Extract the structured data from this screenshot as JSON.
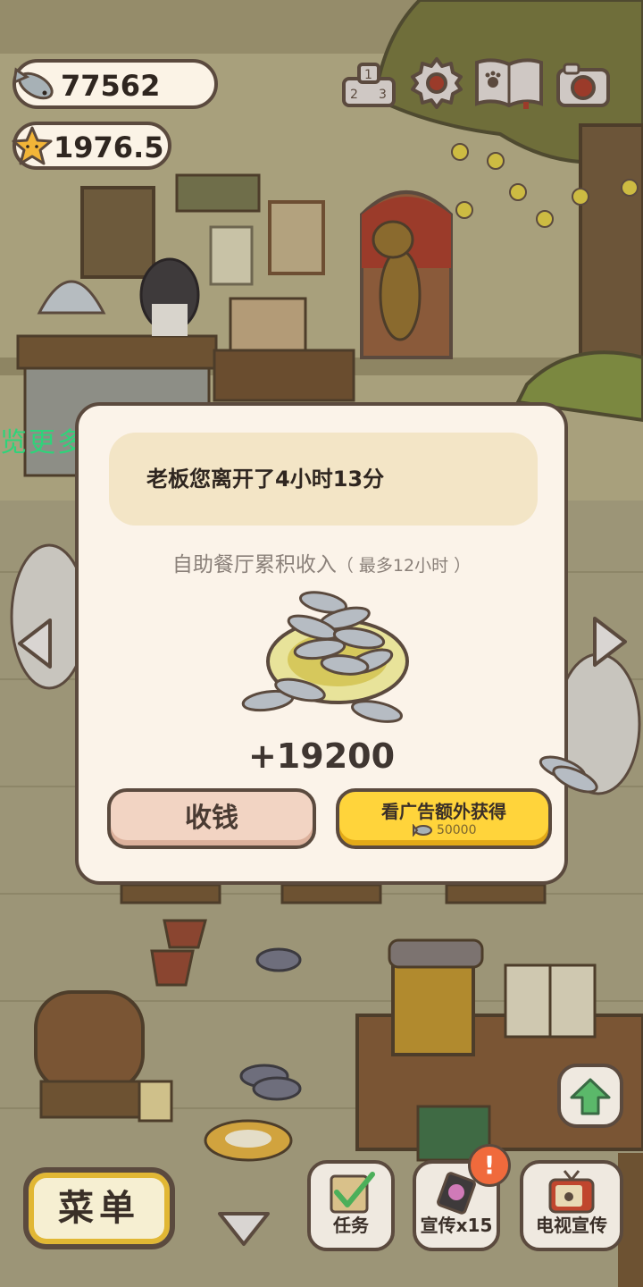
{
  "currency": {
    "fish_count": "77562",
    "star_rating": "1976.5"
  },
  "top_icons": [
    "ranking-icon",
    "settings-gear-icon",
    "cat-book-icon",
    "camera-icon"
  ],
  "marquee": {
    "text": "览更多的顾客"
  },
  "dialog": {
    "notice": "老板您离开了4小时13分",
    "subtitle_main": "自助餐厅累积收入",
    "subtitle_note": "（ 最多12小时 ）",
    "amount": "+19200",
    "collect_label": "收钱",
    "ad_label": "看广告额外获得",
    "ad_amount": "50000"
  },
  "bottom_bar": {
    "menu_label": "菜单",
    "tasks_label": "任务",
    "promo_label": "宣传x15",
    "tv_label": "电视宣传",
    "alert_badge": "!"
  },
  "colors": {
    "outline": "#5b4a3e",
    "panel": "#fbf3e9",
    "notice_bg": "#f3e5c6",
    "ad_yellow": "#ffd43b",
    "collect_pink": "#f2d4c3",
    "marquee_green": "#2fd37a",
    "alert_orange": "#f06a3c"
  }
}
